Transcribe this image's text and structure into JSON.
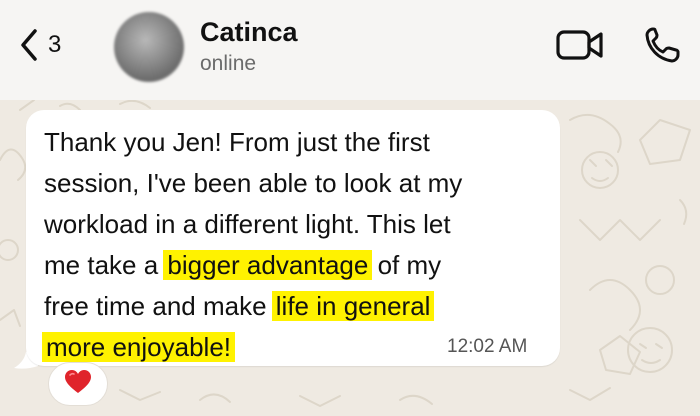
{
  "header": {
    "back_count": "3",
    "contact_name": "Catinca",
    "contact_status": "online"
  },
  "message": {
    "line1": "Thank you Jen! From just the first",
    "line2": "session, I've been able to look at my",
    "line3": "workload in a different light. This let",
    "line4_before": "me take a ",
    "highlight1": "bigger advantage",
    "line4_after": " of my",
    "line5_before": "free time and make ",
    "highlight2": "life in general",
    "highlight3": "more enjoyable!",
    "timestamp": "12:02 AM",
    "highlight_color": "#fff200"
  },
  "reaction": {
    "emoji": "heart",
    "color": "#e0242b"
  },
  "colors": {
    "header_bg": "#f6f5f3",
    "chat_bg": "#efeae2",
    "bubble_bg": "#ffffff"
  }
}
